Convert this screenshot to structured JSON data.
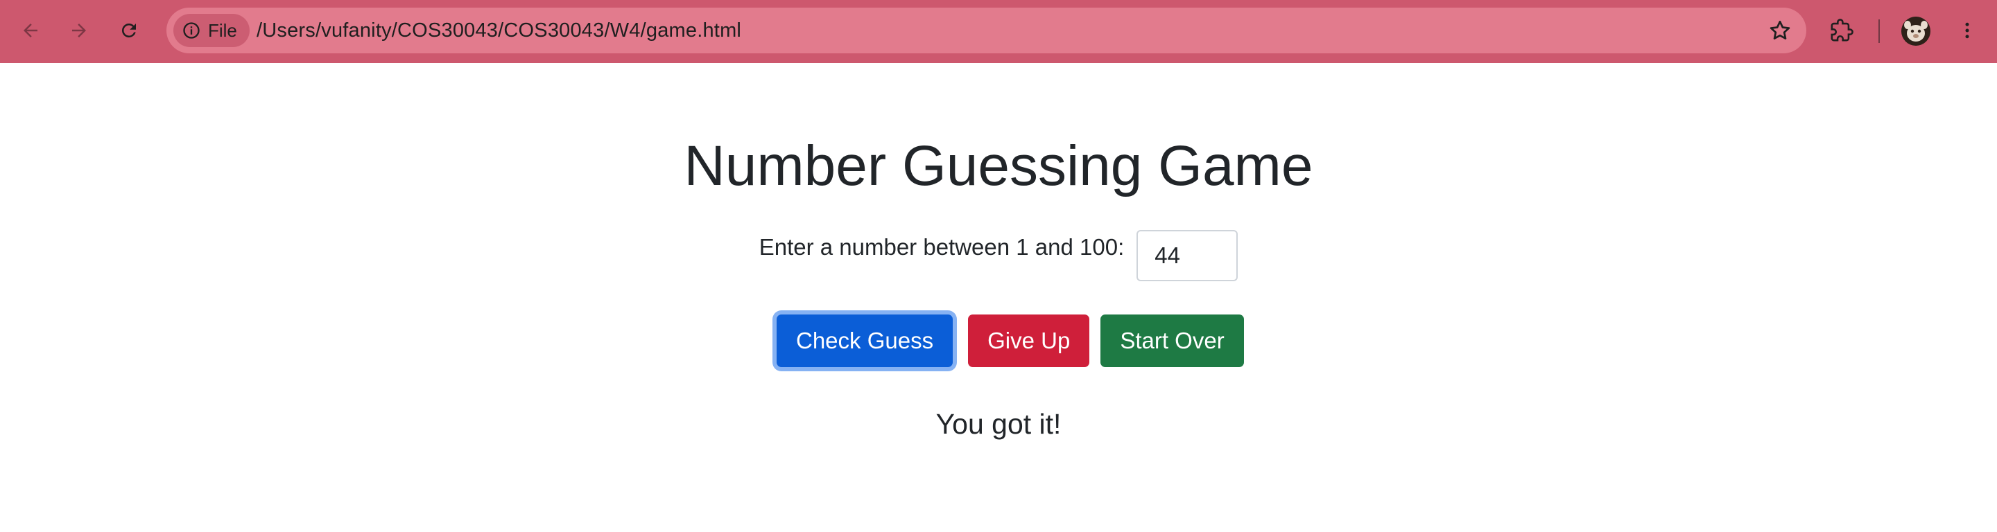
{
  "browser": {
    "chip_label": "File",
    "url": "/Users/vufanity/COS30043/COS30043/W4/game.html",
    "colors": {
      "frame": "#cd586e",
      "omnibox": "#e27b8d"
    }
  },
  "icons": {
    "back": "arrow-left-icon",
    "forward": "arrow-right-icon",
    "reload": "reload-icon",
    "info": "info-icon",
    "bookmark": "star-icon",
    "extensions": "puzzle-icon",
    "profile": "avatar",
    "menu": "kebab-menu-icon"
  },
  "page": {
    "title": "Number Guessing Game",
    "prompt": "Enter a number between 1 and 100:",
    "guess_value": "44",
    "buttons": {
      "check": "Check Guess",
      "give_up": "Give Up",
      "start_over": "Start Over"
    },
    "result": "You got it!",
    "colors": {
      "primary": "#0b5ed7",
      "danger": "#cf1f3a",
      "success": "#1e7a44"
    }
  }
}
